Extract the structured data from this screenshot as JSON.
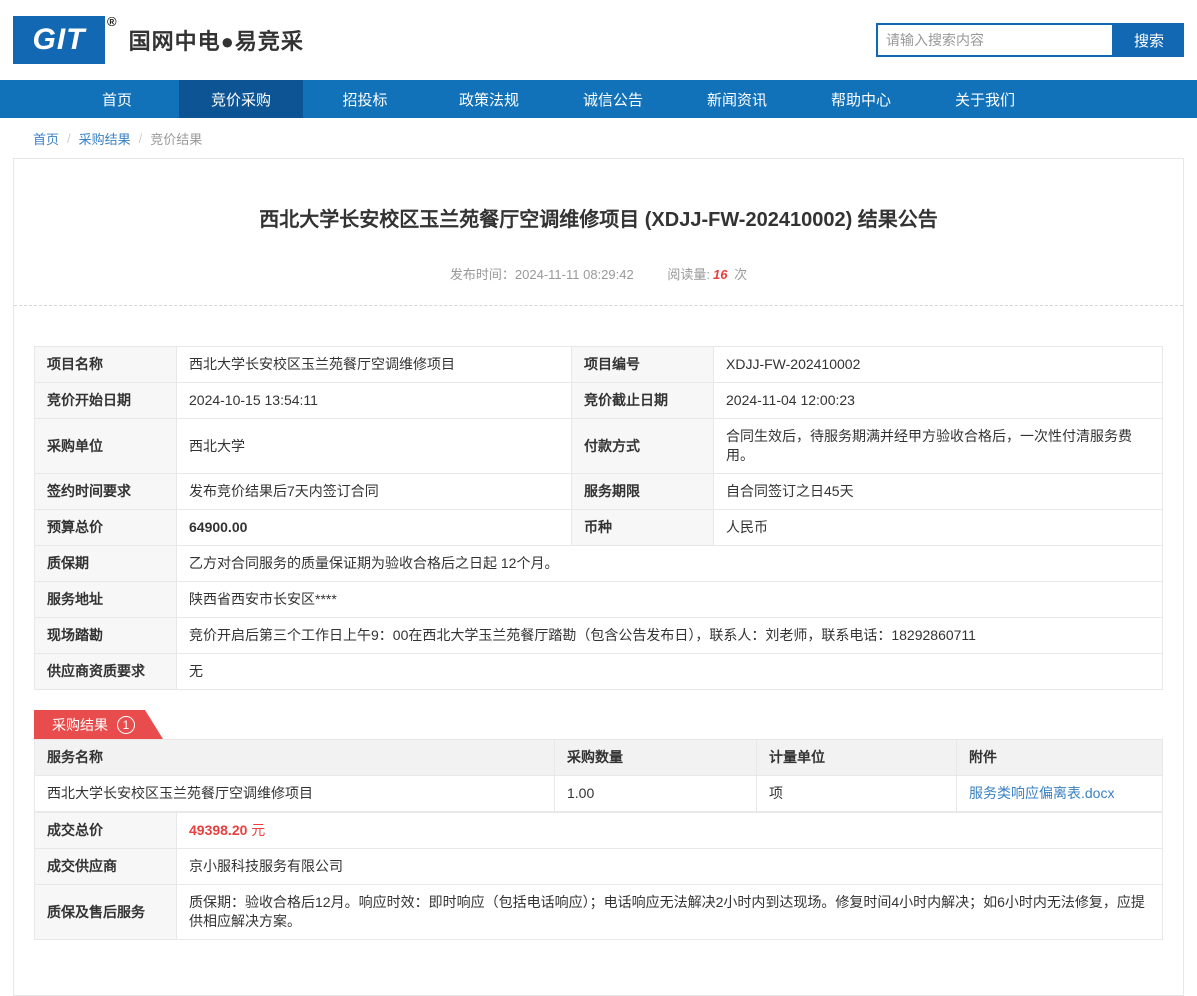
{
  "header": {
    "logo_text": "GIT",
    "logo_trademark": "®",
    "brand": "国网中电●易竞采",
    "search_placeholder": "请输入搜索内容",
    "search_button": "搜索"
  },
  "nav": {
    "items": [
      {
        "label": "首页"
      },
      {
        "label": "竞价采购"
      },
      {
        "label": "招投标"
      },
      {
        "label": "政策法规"
      },
      {
        "label": "诚信公告"
      },
      {
        "label": "新闻资讯"
      },
      {
        "label": "帮助中心"
      },
      {
        "label": "关于我们"
      }
    ],
    "active_index": 1
  },
  "breadcrumb": {
    "home": "首页",
    "section": "采购结果",
    "current": "竞价结果",
    "separator": "/"
  },
  "article": {
    "title": "西北大学长安校区玉兰苑餐厅空调维修项目 (XDJJ-FW-202410002) 结果公告",
    "publish_label": "发布时间：",
    "publish_time": "2024-11-11 08:29:42",
    "views_label": "阅读量:",
    "views_count": "16",
    "views_unit": "次"
  },
  "project": {
    "name_label": "项目名称",
    "name": "西北大学长安校区玉兰苑餐厅空调维修项目",
    "code_label": "项目编号",
    "code": "XDJJ-FW-202410002",
    "start_label": "竞价开始日期",
    "start": "2024-10-15 13:54:11",
    "end_label": "竞价截止日期",
    "end": "2024-11-04 12:00:23",
    "buyer_label": "采购单位",
    "buyer": "西北大学",
    "payment_label": "付款方式",
    "payment": "合同生效后，待服务期满并经甲方验收合格后，一次性付清服务费用。",
    "sign_label": "签约时间要求",
    "sign": "发布竞价结果后7天内签订合同",
    "period_label": "服务期限",
    "period": "自合同签订之日45天",
    "budget_label": "预算总价",
    "budget": "64900.00",
    "currency_label": "币种",
    "currency": "人民币",
    "warranty_label": "质保期",
    "warranty": "乙方对合同服务的质量保证期为验收合格后之日起 12个月。",
    "address_label": "服务地址",
    "address": "陕西省西安市长安区****",
    "survey_label": "现场踏勘",
    "survey": "竞价开启后第三个工作日上午9：00在西北大学玉兰苑餐厅踏勘（包含公告发布日），联系人：刘老师，联系电话：18292860711",
    "qualification_label": "供应商资质要求",
    "qualification": "无"
  },
  "result": {
    "badge_label": "采购结果",
    "badge_count": "1",
    "headers": {
      "service": "服务名称",
      "quantity": "采购数量",
      "unit": "计量单位",
      "attachment": "附件"
    },
    "row": {
      "service": "西北大学长安校区玉兰苑餐厅空调维修项目",
      "quantity": "1.00",
      "unit": "项",
      "attachment": "服务类响应偏离表.docx"
    },
    "total_label": "成交总价",
    "total_value": "49398.20",
    "total_unit": "元",
    "supplier_label": "成交供应商",
    "supplier": "京小服科技服务有限公司",
    "aftersale_label": "质保及售后服务",
    "aftersale": "质保期：验收合格后12月。响应时效：即时响应（包括电话响应）；电话响应无法解决2小时内到达现场。修复时间4小时内解决；如6小时内无法修复，应提供相应解决方案。"
  }
}
